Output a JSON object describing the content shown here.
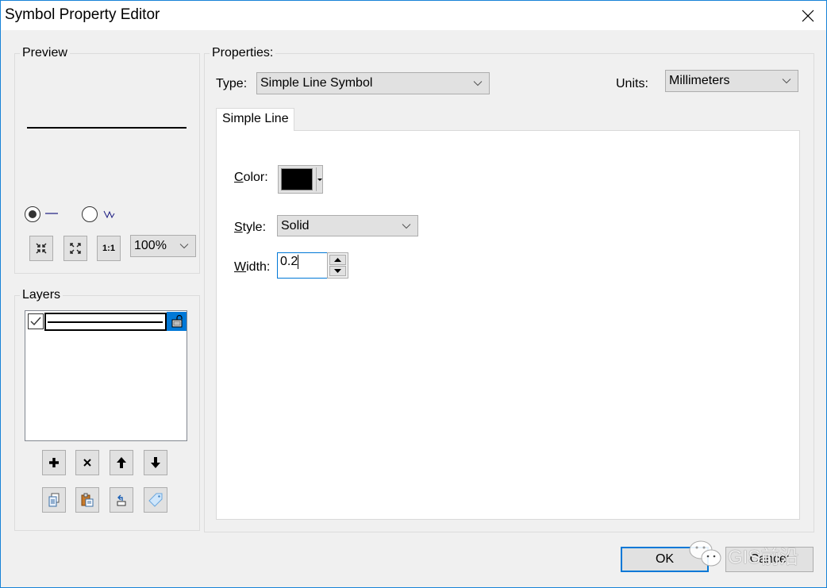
{
  "window": {
    "title": "Symbol Property Editor",
    "close_icon": "close-icon"
  },
  "preview": {
    "group_label": "Preview",
    "line_color": "#000000",
    "radio_line_label": "line-preview",
    "radio_line_checked": true,
    "radio_zigzag_label": "zigzag-preview",
    "radio_zigzag_checked": false,
    "buttons": [
      {
        "name": "zoom-in-preview-button",
        "icon": "shrink-arrows-icon"
      },
      {
        "name": "zoom-out-preview-button",
        "icon": "expand-arrows-icon"
      },
      {
        "name": "actual-size-button",
        "icon": "one-to-one-icon",
        "glyph": "1:1"
      }
    ],
    "zoom_value": "100%"
  },
  "layers": {
    "group_label": "Layers",
    "items": [
      {
        "checked": true,
        "symbol": "solid-line",
        "locked": false,
        "selected_color": "#0078d7"
      }
    ],
    "buttons_row1": [
      {
        "name": "add-layer-button",
        "icon": "plus-icon"
      },
      {
        "name": "remove-layer-button",
        "icon": "x-icon"
      },
      {
        "name": "move-layer-up-button",
        "icon": "arrow-up-icon"
      },
      {
        "name": "move-layer-down-button",
        "icon": "arrow-down-icon"
      }
    ],
    "buttons_row2": [
      {
        "name": "copy-layer-button",
        "icon": "copy-icon"
      },
      {
        "name": "paste-layer-button",
        "icon": "paste-icon"
      },
      {
        "name": "reset-layer-button",
        "icon": "reset-icon"
      },
      {
        "name": "tag-layer-button",
        "icon": "tag-icon"
      }
    ]
  },
  "properties": {
    "group_label": "Properties:",
    "type_label": "Type:",
    "type_value": "Simple Line Symbol",
    "units_label": "Units:",
    "units_value": "Millimeters",
    "tabs": [
      {
        "label": "Simple Line",
        "active": true
      }
    ],
    "color_label_u": "C",
    "color_label_rest": "olor:",
    "color_value": "#000000",
    "style_label_u": "S",
    "style_label_rest": "tyle:",
    "style_value": "Solid",
    "width_label_u": "W",
    "width_label_rest": "idth:",
    "width_value": "0.2"
  },
  "footer": {
    "ok_label": "OK",
    "cancel_label": "Cancel",
    "watermark_text": "GIS前沿"
  }
}
